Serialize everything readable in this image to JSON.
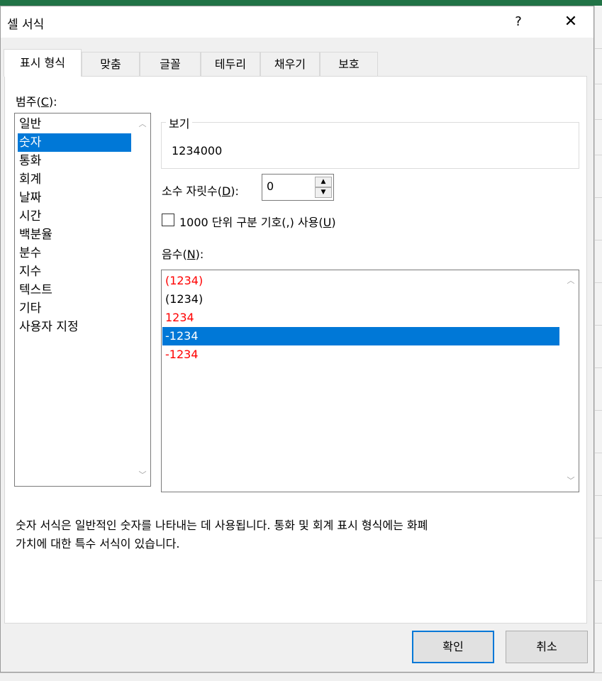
{
  "dialog": {
    "title": "셀 서식",
    "help_label": "?",
    "close_label": "✕"
  },
  "tabs": [
    {
      "label": "표시 형식",
      "active": true
    },
    {
      "label": "맞춤"
    },
    {
      "label": "글꼴"
    },
    {
      "label": "테두리"
    },
    {
      "label": "채우기"
    },
    {
      "label": "보호"
    }
  ],
  "category": {
    "label": "범주",
    "accel": "C",
    "items": [
      "일반",
      "숫자",
      "통화",
      "회계",
      "날짜",
      "시간",
      "백분율",
      "분수",
      "지수",
      "텍스트",
      "기타",
      "사용자 지정"
    ],
    "selected": "숫자"
  },
  "preview": {
    "label": "보기",
    "value": "1234000"
  },
  "decimal_places": {
    "label": "소수 자릿수",
    "accel": "D",
    "value": "0"
  },
  "thousands_separator": {
    "label_before": "1000 단위 구분 기호(,) 사용",
    "accel": "U",
    "checked": false
  },
  "negative_numbers": {
    "label": "음수",
    "accel": "N",
    "items": [
      {
        "text": "(1234)",
        "color": "#ff0000"
      },
      {
        "text": "(1234)",
        "color": "#000000"
      },
      {
        "text": "1234",
        "color": "#ff0000"
      },
      {
        "text": "-1234",
        "color": "#000000",
        "selected": true
      },
      {
        "text": "-1234",
        "color": "#ff0000"
      }
    ]
  },
  "description": {
    "line1": "숫자 서식은 일반적인 숫자를 나타내는 데 사용됩니다. 통화 및 회계 표시 형식에는 화폐",
    "line2": "가치에 대한 특수 서식이 있습니다."
  },
  "buttons": {
    "ok": "확인",
    "cancel": "취소"
  },
  "colors": {
    "selection": "#0078d7",
    "negative_red": "#ff0000",
    "excel_green": "#217346"
  }
}
